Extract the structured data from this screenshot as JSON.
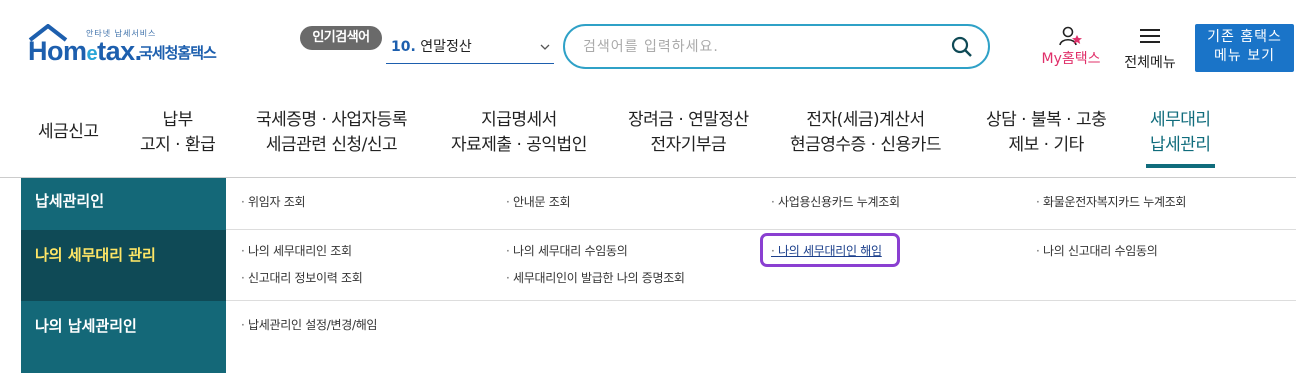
{
  "header": {
    "logo": {
      "small_text": "안타넷 납세서비스",
      "brand": "Hometax.",
      "korean_name": "국세청홈택스"
    },
    "popular_search": {
      "label": "인기검색어",
      "rank": "10.",
      "keyword": "연말정산"
    },
    "search": {
      "placeholder": "검색어를 입력하세요."
    },
    "my_hometax_label": "My홈택스",
    "all_menu_label": "전체메뉴",
    "legacy_button": {
      "line1": "기존 홈택스",
      "line2": "메뉴 보기"
    }
  },
  "gnb": {
    "items": [
      {
        "line1": "세금신고",
        "line2": ""
      },
      {
        "line1": "납부",
        "line2": "고지 · 환급"
      },
      {
        "line1": "국세증명 · 사업자등록",
        "line2": "세금관련 신청/신고"
      },
      {
        "line1": "지급명세서",
        "line2": "자료제출 · 공익법인"
      },
      {
        "line1": "장려금 · 연말정산",
        "line2": "전자기부금"
      },
      {
        "line1": "전자(세금)계산서",
        "line2": "현금영수증 · 신용카드"
      },
      {
        "line1": "상담 · 불복 · 고충",
        "line2": "제보 · 기타"
      },
      {
        "line1": "세무대리",
        "line2": "납세관리"
      }
    ]
  },
  "submenu": {
    "sections": [
      {
        "title": "납세관리인",
        "links": [
          "위임자 조회",
          "안내문 조회",
          "사업용신용카드 누계조회",
          "화물운전자복지카드 누계조회"
        ]
      },
      {
        "title": "나의 세무대리 관리",
        "links": [
          "나의 세무대리인 조회",
          "나의 세무대리 수임동의",
          "나의 세무대리인 해임",
          "나의 신고대리 수임동의",
          "신고대리 정보이력 조회",
          "세무대리인이 발급한 나의 증명조회"
        ]
      },
      {
        "title": "나의 납세관리인",
        "links": [
          "납세관리인 설정/변경/해임"
        ]
      }
    ]
  },
  "colors": {
    "accent": "#106c7c",
    "highlight": "#8a3fd1",
    "brand_blue": "#1d5fae",
    "my_pink": "#e0306a"
  }
}
